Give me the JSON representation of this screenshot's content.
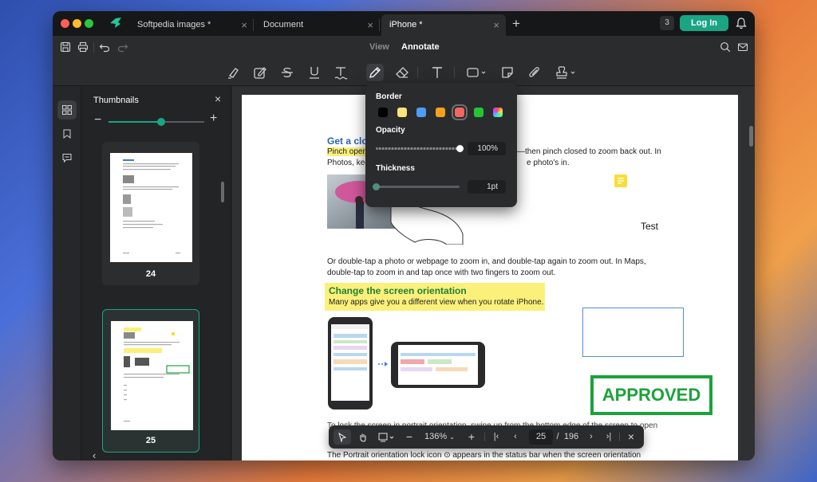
{
  "tabs": [
    {
      "label": "Softpedia images *"
    },
    {
      "label": "Document"
    },
    {
      "label": "iPhone *"
    }
  ],
  "titlebar": {
    "notification_count": "3",
    "login_label": "Log In",
    "add_tab": "+"
  },
  "modes": {
    "view": "View",
    "annotate": "Annotate"
  },
  "sidebar": {
    "title": "Thumbnails",
    "close": "×",
    "zoom_minus": "−",
    "zoom_plus": "+",
    "zoom_level": 0.55,
    "back": "‹",
    "thumbnails": [
      {
        "page": "24",
        "selected": false
      },
      {
        "page": "25",
        "selected": true
      }
    ]
  },
  "annotation_popup": {
    "border_label": "Border",
    "colors": [
      "#000000",
      "#fbe47a",
      "#4f9cf9",
      "#f7a020",
      "#f0675f",
      "#24c534",
      "rainbow"
    ],
    "selected_color": "#f0675f",
    "opacity_label": "Opacity",
    "opacity_value": "100",
    "opacity_unit": "%",
    "opacity_fraction": 1.0,
    "thickness_label": "Thickness",
    "thickness_value": "1",
    "thickness_unit": "pt",
    "thickness_fraction": 0.0
  },
  "document": {
    "heading1": "Get a clo",
    "line1_hl": "Pinch oper",
    "line1_rest": "—then pinch closed to zoom back out. In",
    "line2a": "Photos, kee",
    "line2b": "e photo's in.",
    "para2_l1": "Or double-tap a photo or webpage to zoom in, and double-tap again to zoom out. In Maps,",
    "para2_l2": "double-tap to zoom in and tap once with two fingers to zoom out.",
    "orient_title": "Change the screen orientation",
    "orient_sub": "Many apps give you a different view when you rotate iPhone.",
    "test_text": "Test",
    "approved": "APPROVED",
    "para3_l1": "To lock the screen in portrait orientation, swipe up from the bottom edge of the screen to open",
    "para4_l1": "The Portrait orientation lock icon",
    "para4_l2": "appears in the status bar when the screen orientation"
  },
  "bottom_nav": {
    "zoom": "136%",
    "current_page": "25",
    "page_separator": "/",
    "total_pages": "196",
    "minus": "−",
    "plus": "+",
    "close": "×"
  }
}
